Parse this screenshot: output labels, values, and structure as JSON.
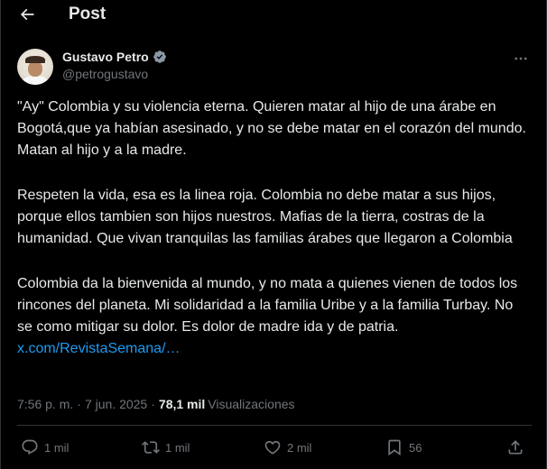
{
  "header": {
    "title": "Post"
  },
  "author": {
    "name": "Gustavo Petro",
    "handle": "@petrogustavo"
  },
  "post": {
    "paragraph_1": "\"Ay\" Colombia y su violencia eterna. Quieren matar al hijo de una árabe en Bogotá,que ya habían asesinado, y no se debe matar en el corazón del mundo. Matan al hijo y a la madre.",
    "paragraph_2": "Respeten la vida, esa es la linea roja. Colombia no debe matar a sus hijos, porque ellos tambien son hijos nuestros. Mafias de la tierra, costras de la humanidad. Que vivan tranquilas las familias árabes que llegaron a Colombia",
    "paragraph_3": "Colombia da la bienvenida al mundo, y no mata a quienes vienen de todos los rincones del planeta. Mi solidaridad a la familia Uribe y a la familia Turbay. No se como mitigar su dolor. Es dolor de madre ida y de patria. ",
    "link_text": "x.com/RevistaSemana/…"
  },
  "meta": {
    "time": "7:56 p. m.",
    "separator": "·",
    "date": "7 jun. 2025",
    "views_count": "78,1 mil",
    "views_label": "Visualizaciones"
  },
  "actions": {
    "replies": "1 mil",
    "reposts": "1 mil",
    "likes": "2 mil",
    "bookmarks": "56"
  },
  "colors": {
    "background": "#000000",
    "text": "#e7e9ea",
    "secondary": "#71767b",
    "accent": "#1d9bf0",
    "border": "#2f3336"
  },
  "icons": {
    "back": "arrow-left-icon",
    "verified": "verified-badge-icon",
    "more": "more-horizontal-icon",
    "reply": "reply-icon",
    "repost": "repost-icon",
    "like": "heart-icon",
    "bookmark": "bookmark-icon",
    "share": "share-icon"
  }
}
